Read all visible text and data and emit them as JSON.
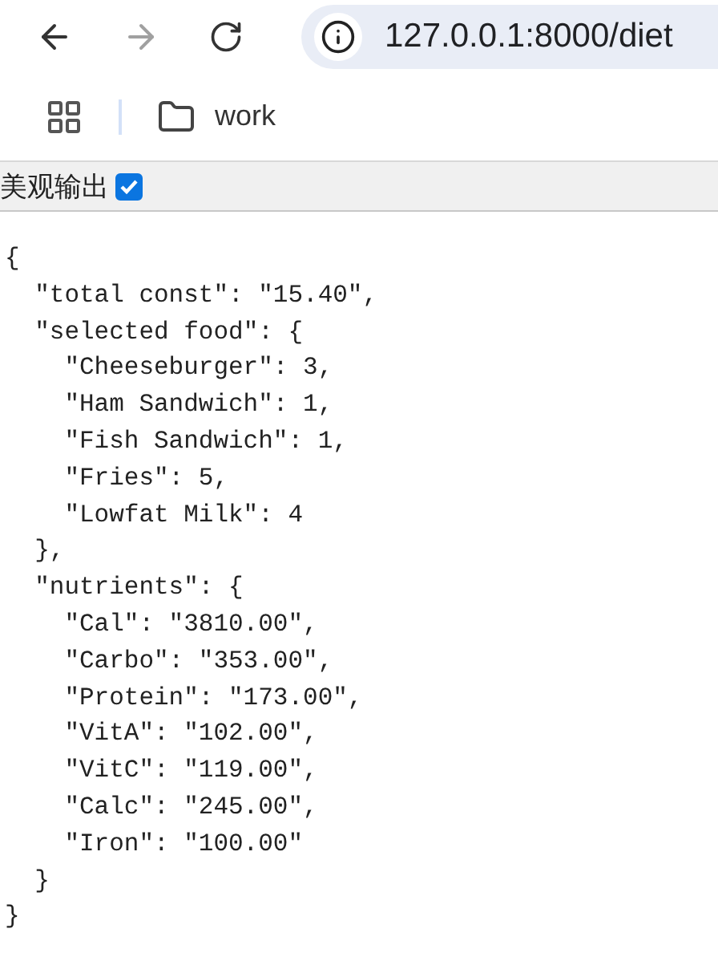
{
  "browser": {
    "address": "127.0.0.1:8000/diet",
    "forward_disabled": true
  },
  "bookmarks": [
    {
      "label": "work"
    }
  ],
  "options_bar": {
    "label": "美观输出",
    "checked": true
  },
  "json_view": {
    "text": "{",
    "close": "}",
    "children": [
      {
        "text": "\"total const\": \"15.40\","
      },
      {
        "text": "\"selected food\": {",
        "close": "},",
        "children": [
          {
            "text": "\"Cheeseburger\": 3,"
          },
          {
            "text": "\"Ham Sandwich\": 1,"
          },
          {
            "text": "\"Fish Sandwich\": 1,"
          },
          {
            "text": "\"Fries\": 5,"
          },
          {
            "text": "\"Lowfat Milk\": 4"
          }
        ]
      },
      {
        "text": "\"nutrients\": {",
        "close": "}",
        "children": [
          {
            "text": "\"Cal\": \"3810.00\","
          },
          {
            "text": "\"Carbo\": \"353.00\","
          },
          {
            "text": "\"Protein\": \"173.00\","
          },
          {
            "text": "\"VitA\": \"102.00\","
          },
          {
            "text": "\"VitC\": \"119.00\","
          },
          {
            "text": "\"Calc\": \"245.00\","
          },
          {
            "text": "\"Iron\": \"100.00\""
          }
        ]
      }
    ]
  }
}
